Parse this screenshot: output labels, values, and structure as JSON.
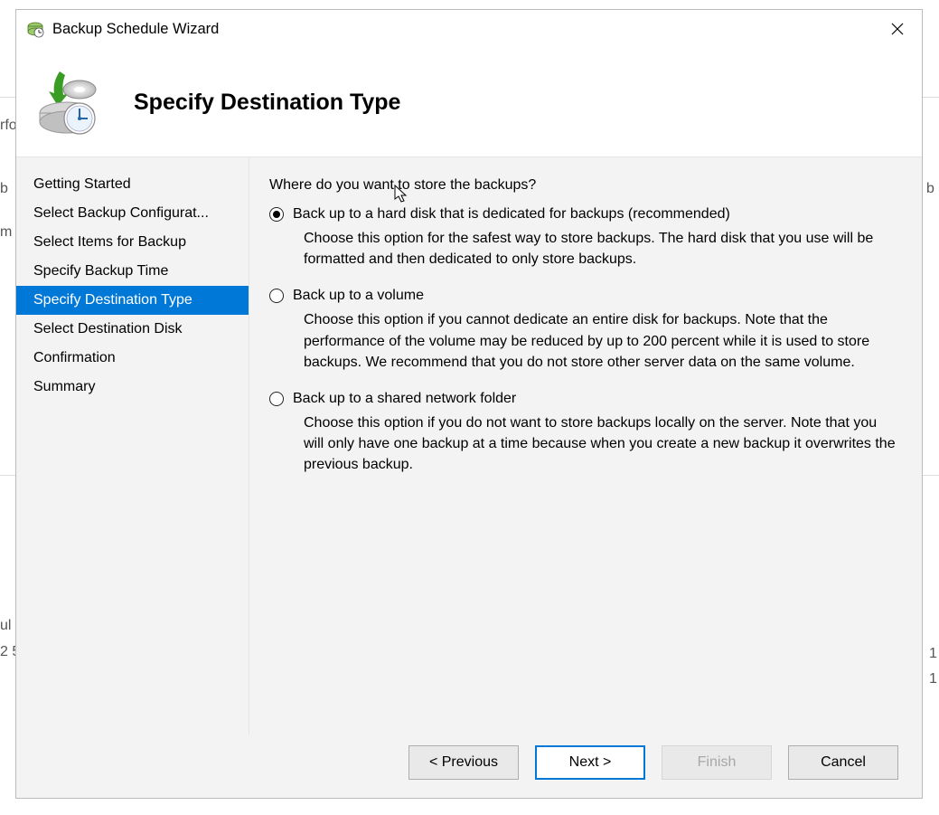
{
  "window": {
    "title": "Backup Schedule Wizard",
    "page_title": "Specify Destination Type"
  },
  "sidebar": {
    "steps": [
      "Getting Started",
      "Select Backup Configurat...",
      "Select Items for Backup",
      "Specify Backup Time",
      "Specify Destination Type",
      "Select Destination Disk",
      "Confirmation",
      "Summary"
    ]
  },
  "content": {
    "prompt": "Where do you want to store the backups?",
    "options": [
      {
        "label": "Back up to a hard disk that is dedicated for backups (recommended)",
        "desc": "Choose this option for the safest way to store backups. The hard disk that you use will be formatted and then dedicated to only store backups."
      },
      {
        "label": "Back up to a volume",
        "desc": "Choose this option if you cannot dedicate an entire disk for backups. Note that the performance of the volume may be reduced by up to 200 percent while it is used to store backups. We recommend that you do not store other server data on the same volume."
      },
      {
        "label": "Back up to a shared network folder",
        "desc": "Choose this option if you do not want to store backups locally on the server. Note that you will only have one backup at a time because when you create a new backup it overwrites the previous backup."
      }
    ]
  },
  "buttons": {
    "previous": "< Previous",
    "next": "Next >",
    "finish": "Finish",
    "cancel": "Cancel"
  },
  "bg_fragments": {
    "a": "rfo",
    "b": "b",
    "c": "b",
    "d": "m",
    "e": "ul",
    "f": "2 5",
    "g": "1",
    "h": "1"
  }
}
